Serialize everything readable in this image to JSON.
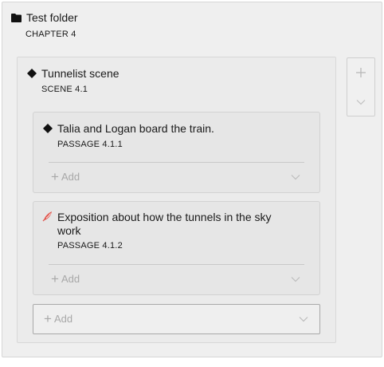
{
  "folder": {
    "title": "Test folder",
    "subtitle": "CHAPTER 4",
    "icon": "folder-icon"
  },
  "scene": {
    "title": "Tunnelist scene",
    "subtitle": "SCENE 4.1",
    "icon": "diamond-icon",
    "add_label": "Add"
  },
  "passages": [
    {
      "title": "Talia and Logan board the train.",
      "subtitle": "PASSAGE 4.1.1",
      "icon": "diamond-icon",
      "add_label": "Add"
    },
    {
      "title_line1": "Exposition about how the tunnels in the sky",
      "title_line2": "work",
      "subtitle": "PASSAGE 4.1.2",
      "icon": "quill-icon",
      "icon_color": "#e0574f",
      "add_label": "Add"
    }
  ],
  "side_controls": {
    "add_icon": "plus-icon",
    "expand_icon": "chevron-down-icon"
  },
  "colors": {
    "panel_bg": "#efefef",
    "placeholder_text": "#a8a8a8",
    "accent_quill": "#e0574f"
  }
}
